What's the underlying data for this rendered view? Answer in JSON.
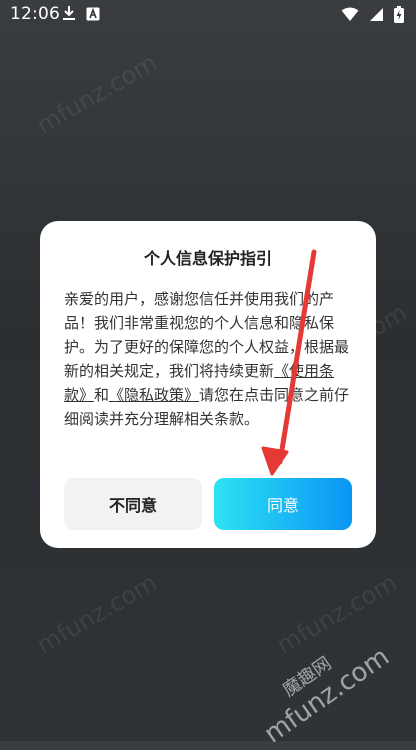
{
  "status_bar": {
    "time": "12:06",
    "icons": [
      "download-icon",
      "a-notification-icon",
      "wifi-icon",
      "signal-icon",
      "battery-charging-icon"
    ]
  },
  "watermarks": {
    "text": "mfunz.com",
    "brand": "魔趣网"
  },
  "dialog": {
    "title": "个人信息保护指引",
    "body_part1": "亲爱的用户，感谢您信任并使用我们的产品！我们非常重视您的个人信息和隐私保护。为了更好的保障您的个人权益，根据最新的相关规定，我们将持续更新",
    "terms_link": "《使用条款》",
    "and_text": "和",
    "privacy_link": "《隐私政策》",
    "body_part2": "请您在点击同意之前仔细阅读并充分理解相关条款。",
    "disagree_label": "不同意",
    "agree_label": "同意"
  },
  "colors": {
    "agree_gradient_start": "#2de3f2",
    "agree_gradient_end": "#0a94f5",
    "annotation_arrow": "#e53935"
  }
}
